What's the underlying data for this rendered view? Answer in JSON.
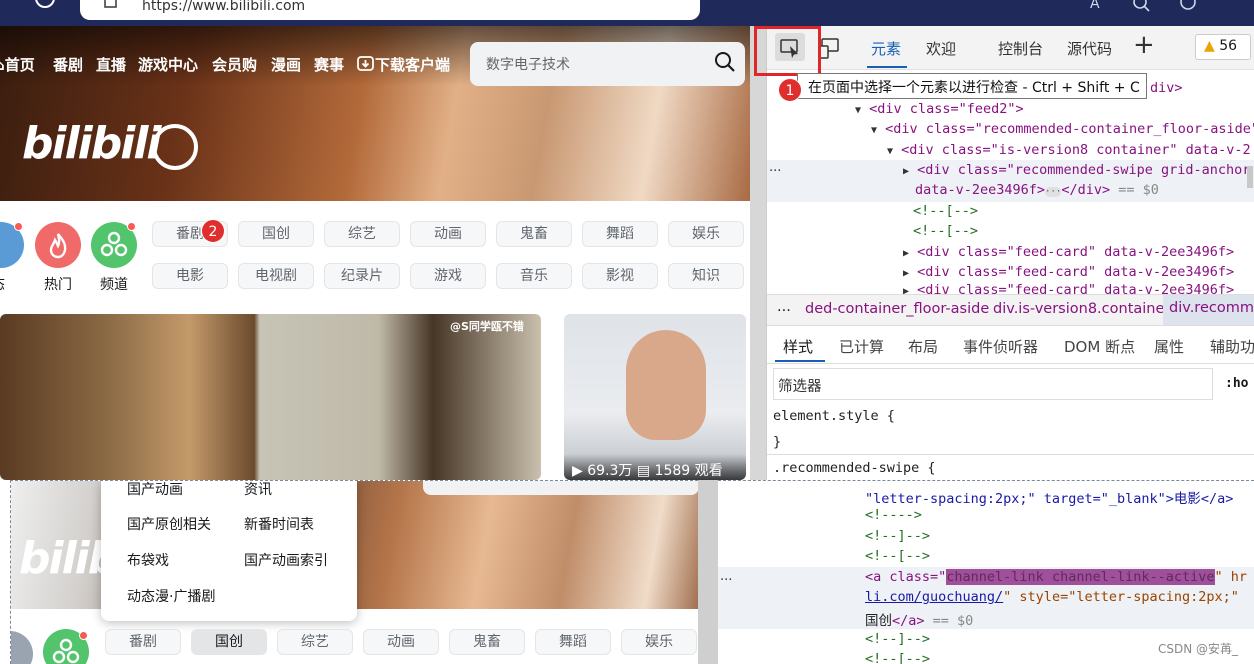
{
  "browser": {
    "url": "https://www.bilibili.com"
  },
  "site": {
    "nav": [
      "首页",
      "番剧",
      "直播",
      "游戏中心",
      "会员购",
      "漫画",
      "赛事",
      "下载客户端"
    ],
    "search_placeholder": "数字电子技术",
    "logo": "bilibili",
    "circles": [
      {
        "label": "态",
        "color": "#5a9bd5"
      },
      {
        "label": "热门",
        "color": "#f06a6a"
      },
      {
        "label": "频道",
        "color": "#52c46b"
      }
    ],
    "channels_row1": [
      "番剧",
      "国创",
      "综艺",
      "动画",
      "鬼畜",
      "舞蹈",
      "娱乐"
    ],
    "channels_row2": [
      "电影",
      "电视剧",
      "纪录片",
      "游戏",
      "音乐",
      "影视",
      "知识"
    ],
    "video1_tag": "@S同学瓯不错",
    "video2_views": "69.3万",
    "video2_comments": "1589",
    "video2_extra": "观看"
  },
  "devtools": {
    "tabs": [
      "元素",
      "欢迎",
      "控制台",
      "源代码"
    ],
    "add_tab": "+",
    "warning_count": "56",
    "tooltip": "在页面中选择一个元素以进行检查 - Ctrl + Shift + C",
    "badge1": "1",
    "badge2": "2",
    "code_lines": {
      "l0_tail": "div>",
      "l1": "<div class=\"feed2\">",
      "l2": "<div class=\"recommended-container_floor-aside\"",
      "l3": "<div class=\"is-version8 container\" data-v-2",
      "l4": "<div class=\"recommended-swipe grid-anchor",
      "l5a": "data-v-2ee3496f>",
      "l5b": "</div>",
      "l5c": "== $0",
      "l6": "<!--[-->",
      "l7": "<!--[-->",
      "l8": "<div class=\"feed-card\" data-v-2ee3496f>",
      "l9": "<div class=\"feed-card\" data-v-2ee3496f>",
      "l10": "<div class=\"feed-card\" data-v-2ee3496f>"
    },
    "dots": "...",
    "breadcrumb": [
      "...",
      "ded-container_floor-aside",
      "div.is-version8.container",
      "div.recomm"
    ],
    "style_tabs": [
      "样式",
      "已计算",
      "布局",
      "事件侦听器",
      "DOM 断点",
      "属性",
      "辅助功"
    ],
    "filter_placeholder": "筛选器",
    "hov": ":ho",
    "css": {
      "element_style": "element.style {",
      "close_brace": "}",
      "rule": ".recommended-swipe {"
    }
  },
  "overlay": {
    "dropdown_items": [
      [
        "国产动画",
        "资讯"
      ],
      [
        "国产原创相关",
        "新番时间表"
      ],
      [
        "布袋戏",
        "国产动画索引"
      ],
      [
        "动态漫·广播剧",
        ""
      ]
    ],
    "channels": [
      "番剧",
      "国创",
      "综艺",
      "动画",
      "鬼畜",
      "舞蹈",
      "娱乐"
    ],
    "code": {
      "c1": "\"letter-spacing:2px;\" target=\"_blank\">电影</a>",
      "c2": "<!---->",
      "c3": "<!--]-->",
      "c4": "<!--[-->",
      "c5a": "<a class=\"",
      "c5b": "channel-link channel-link--active",
      "c5c": "\" hr",
      "c6a": "li.com/guochuang/",
      "c6b": "\" style=\"letter-spacing:2px;\"",
      "c7a": "国创",
      "c7b": "</a>",
      "c7c": "== $0",
      "c8": "<!--]-->",
      "c9": "<!--[-->"
    }
  },
  "watermark": "CSDN @安苒_"
}
